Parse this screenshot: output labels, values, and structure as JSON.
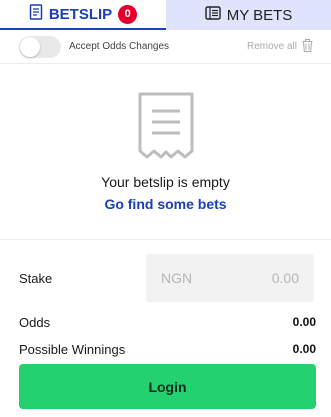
{
  "tabs": {
    "betslip": {
      "label": "BETSLIP",
      "badge": "0",
      "icon": "receipt-icon"
    },
    "mybets": {
      "label": "MY BETS",
      "icon": "list-icon"
    }
  },
  "options": {
    "accept_odds_label": "Accept Odds Changes",
    "accept_odds_on": false,
    "remove_all_label": "Remove all"
  },
  "empty_state": {
    "message": "Your betslip is empty",
    "link": "Go find some bets"
  },
  "stake": {
    "label": "Stake",
    "currency": "NGN",
    "placeholder": "0.00"
  },
  "summary": {
    "odds_label": "Odds",
    "odds_value": "0.00",
    "winnings_label": "Possible Winnings",
    "winnings_value": "0.00"
  },
  "actions": {
    "login_label": "Login"
  },
  "colors": {
    "accent": "#1a3fb8",
    "badge": "#e4002b",
    "tab_inactive_bg": "#dfe3fb",
    "login_bg": "#23d16f"
  }
}
